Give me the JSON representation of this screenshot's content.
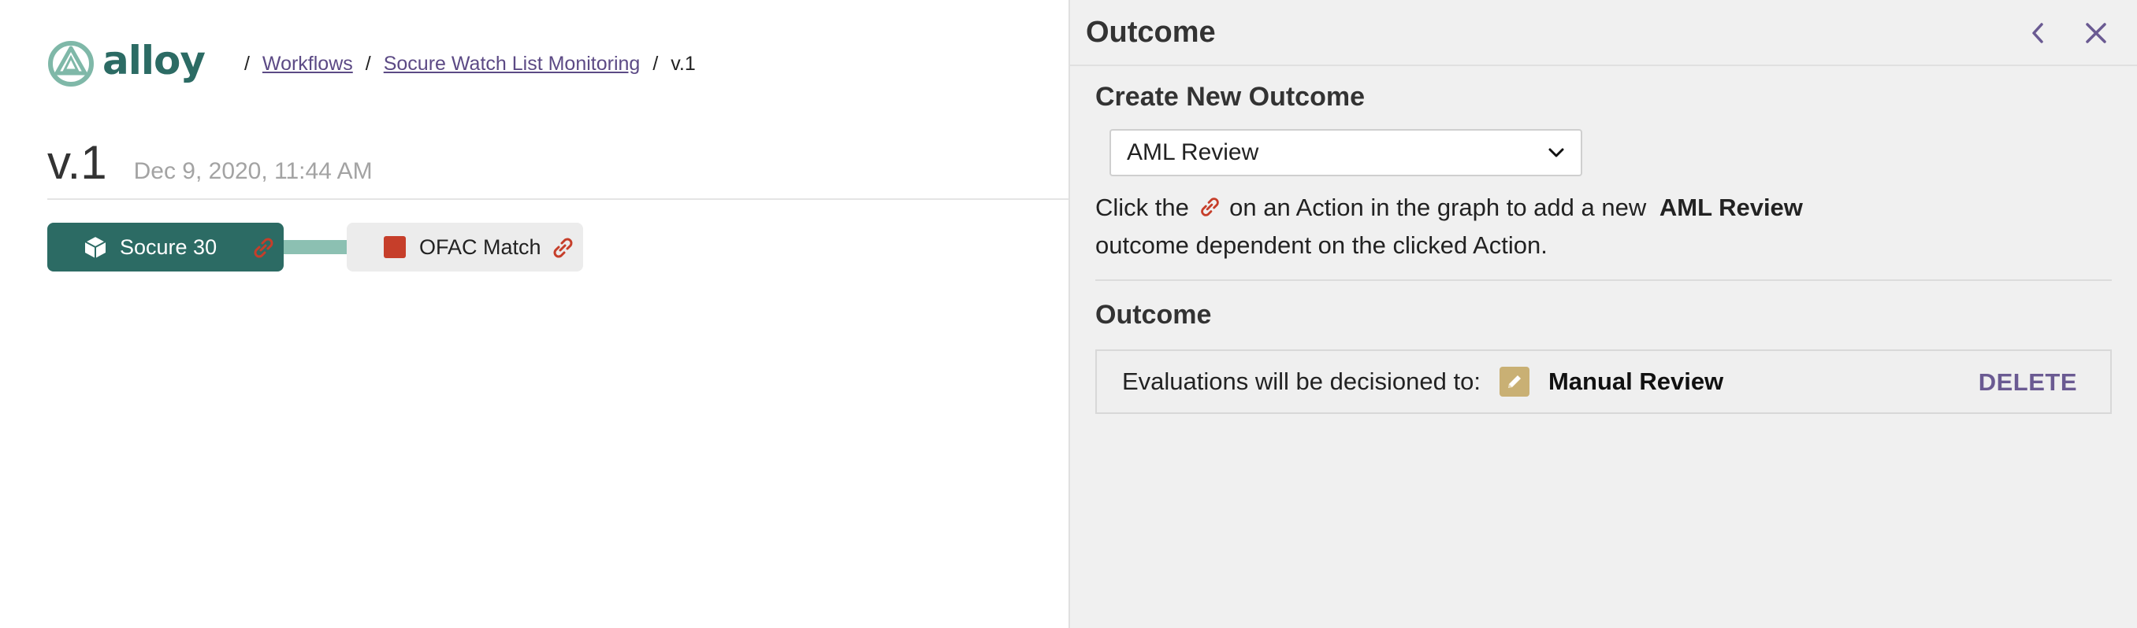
{
  "brand": {
    "name": "alloy"
  },
  "breadcrumb": {
    "items": [
      "Workflows",
      "Socure Watch List Monitoring"
    ],
    "current": "v.1",
    "separator": "/"
  },
  "version": {
    "title": "v.1",
    "date": "Dec 9, 2020, 11:44 AM"
  },
  "graph": {
    "nodes": [
      {
        "label": "Socure 30",
        "icon": "cube-icon"
      },
      {
        "label": "OFAC Match",
        "icon": "red-square-icon"
      }
    ]
  },
  "panel": {
    "title": "Outcome",
    "create": {
      "heading": "Create New Outcome",
      "selected": "AML Review",
      "help_before": "Click the",
      "help_after": "on an Action in the graph to add a new",
      "help_bold": "AML Review",
      "help_end": "outcome dependent on the clicked Action."
    },
    "outcome": {
      "heading": "Outcome",
      "label": "Evaluations will be decisioned to:",
      "value": "Manual Review",
      "delete_label": "DELETE"
    }
  },
  "colors": {
    "brand_teal": "#2c6b64",
    "connector": "#8cc0b2",
    "link_red": "#c63e2a",
    "accent_purple": "#6a5a92",
    "pencil_tan": "#c9b074"
  }
}
